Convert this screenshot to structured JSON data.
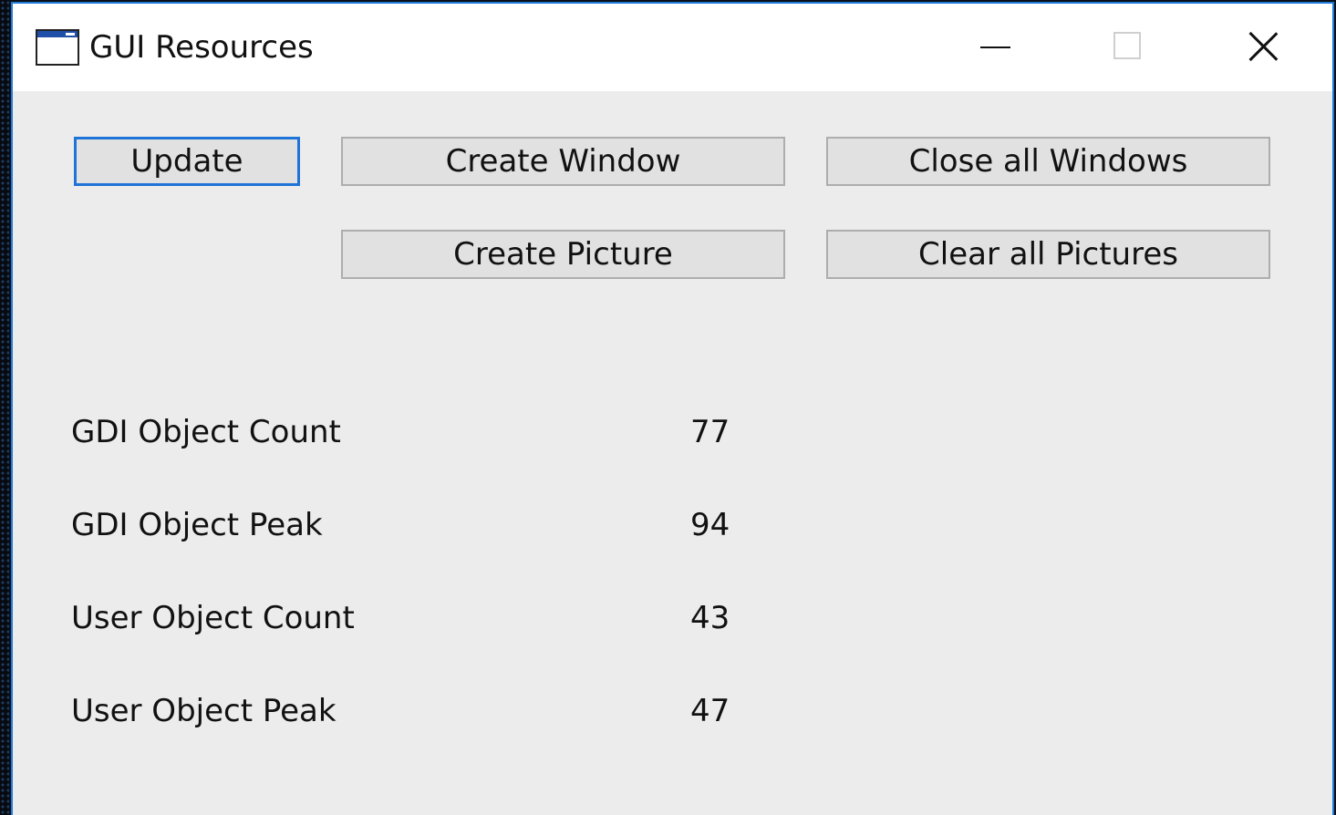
{
  "window": {
    "title": "GUI Resources",
    "app_icon": "window-app-icon",
    "caption_buttons": [
      "minimize-icon",
      "maximize-icon",
      "close-icon"
    ]
  },
  "buttons": {
    "update": "Update",
    "create_window": "Create Window",
    "close_all_windows": "Close all Windows",
    "create_picture": "Create Picture",
    "clear_all_pictures": "Clear all Pictures"
  },
  "stats": [
    {
      "label": "GDI Object Count",
      "value": "77"
    },
    {
      "label": "GDI Object Peak",
      "value": "94"
    },
    {
      "label": "User Object Count",
      "value": "43"
    },
    {
      "label": "User Object Peak",
      "value": "47"
    }
  ],
  "colors": {
    "accent": "#1f74d8",
    "window_bg": "#ececec",
    "titlebar_bg": "#ffffff",
    "button_bg": "#e1e1e1"
  }
}
